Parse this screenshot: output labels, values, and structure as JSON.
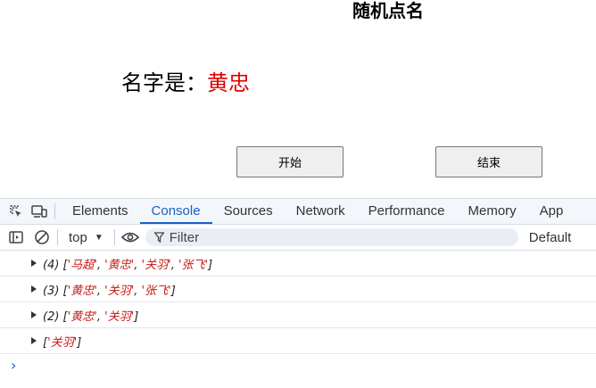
{
  "page": {
    "title": "随机点名",
    "name_label": "名字是：",
    "name_value": "黄忠",
    "start_label": "开始",
    "end_label": "结束"
  },
  "devtools": {
    "tabs": [
      "Elements",
      "Console",
      "Sources",
      "Network",
      "Performance",
      "Memory",
      "App"
    ],
    "active_tab": "Console",
    "context": "top",
    "filter_placeholder": "Filter",
    "levels": "Default",
    "logs": [
      {
        "count": "(4)",
        "items": [
          "马超",
          "黄忠",
          "关羽",
          "张飞"
        ]
      },
      {
        "count": "(3)",
        "items": [
          "黄忠",
          "关羽",
          "张飞"
        ]
      },
      {
        "count": "(2)",
        "items": [
          "黄忠",
          "关羽"
        ]
      },
      {
        "count": "",
        "items": [
          "关羽"
        ]
      }
    ],
    "prompt_symbol": "›"
  },
  "colors": {
    "name_value": "#e00000",
    "active_tab": "#1a5fc7",
    "string": "#c41a16"
  },
  "icons": [
    "inspect-element-icon",
    "device-toolbar-icon",
    "sidebar-toggle-icon",
    "clear-console-icon",
    "eye-icon",
    "filter-icon"
  ]
}
